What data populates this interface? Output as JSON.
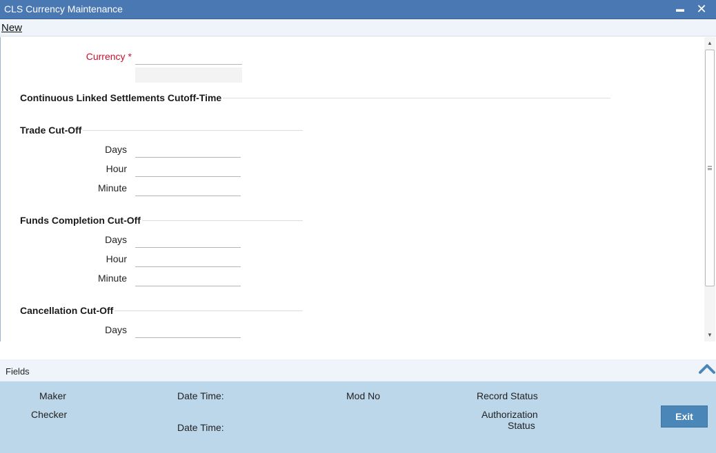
{
  "window": {
    "title": "CLS Currency Maintenance",
    "minimize_glyph": "▬",
    "close_glyph": "✕"
  },
  "menu": {
    "new_label": "New"
  },
  "form": {
    "currency_label": "Currency",
    "required_mark": "*",
    "currency_value": "",
    "currency_description": "",
    "main_section": "Continuous Linked Settlements Cutoff-Time",
    "trade_section": "Trade Cut-Off",
    "funds_section": "Funds Completion Cut-Off",
    "cancellation_section": "Cancellation Cut-Off",
    "days_label": "Days",
    "hour_label": "Hour",
    "minute_label": "Minute"
  },
  "footer": {
    "fields_label": "Fields",
    "maker_label": "Maker",
    "checker_label": "Checker",
    "date_time_label": "Date Time:",
    "mod_no_label": "Mod No",
    "record_status_label": "Record Status",
    "authorization_label": "Authorization",
    "status_label": "Status",
    "exit_label": "Exit"
  },
  "colors": {
    "titlebar": "#4a78b3",
    "required": "#c8102e",
    "audit_panel": "#bcd6ea",
    "exit_button": "#4a86b8"
  },
  "icons": [
    "minimize-icon",
    "close-icon",
    "scroll-up-icon",
    "scroll-down-icon",
    "chevron-up-icon"
  ]
}
